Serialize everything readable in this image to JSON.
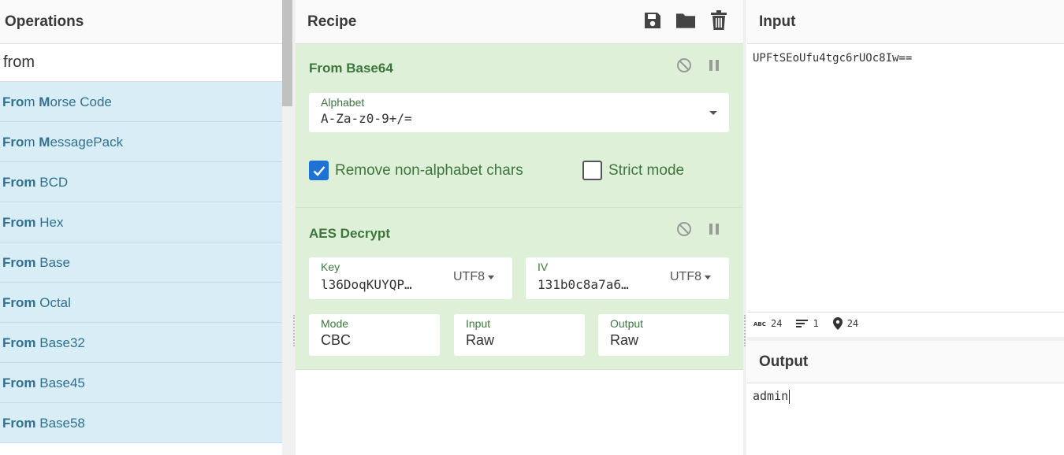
{
  "operations": {
    "title": "Operations",
    "search_value": "from",
    "items": [
      {
        "match": "Fro",
        "mid": "m ",
        "match2": "M",
        "rest": "orse Code"
      },
      {
        "match": "Fro",
        "mid": "m ",
        "match2": "M",
        "rest": "essagePack"
      },
      {
        "match": "From",
        "mid": " ",
        "match2": "",
        "rest": "BCD"
      },
      {
        "match": "From",
        "mid": " ",
        "match2": "",
        "rest": "Hex"
      },
      {
        "match": "From",
        "mid": " ",
        "match2": "",
        "rest": "Base"
      },
      {
        "match": "From",
        "mid": " ",
        "match2": "",
        "rest": "Octal"
      },
      {
        "match": "From",
        "mid": " ",
        "match2": "",
        "rest": "Base32"
      },
      {
        "match": "From",
        "mid": " ",
        "match2": "",
        "rest": "Base45"
      },
      {
        "match": "From",
        "mid": " ",
        "match2": "",
        "rest": "Base58"
      }
    ]
  },
  "recipe": {
    "title": "Recipe",
    "icons": [
      "save-icon",
      "folder-icon",
      "trash-icon"
    ],
    "from_base64": {
      "title": "From Base64",
      "alphabet_label": "Alphabet",
      "alphabet_value": "A-Za-z0-9+/=",
      "remove_label": "Remove non-alphabet chars",
      "remove_checked": true,
      "strict_label": "Strict mode",
      "strict_checked": false
    },
    "aes_decrypt": {
      "title": "AES Decrypt",
      "key_label": "Key",
      "key_value": "l36DoqKUYQP…",
      "key_encoding": "UTF8",
      "iv_label": "IV",
      "iv_value": "131b0c8a7a6…",
      "iv_encoding": "UTF8",
      "mode_label": "Mode",
      "mode_value": "CBC",
      "input_label": "Input",
      "input_value": "Raw",
      "output_label": "Output",
      "output_value": "Raw"
    }
  },
  "input": {
    "title": "Input",
    "text": "UPFtSEoUfu4tgc6rUOc8Iw==",
    "stats": {
      "chars": "24",
      "lines": "1",
      "position": "24"
    }
  },
  "output": {
    "title": "Output",
    "text": "admin"
  },
  "colors": {
    "ops_bg": "#d9edf7",
    "ops_text": "#31708f",
    "recipe_bg": "#dff0d8",
    "recipe_text": "#3c763d",
    "checkbox_on": "#1d72d3"
  }
}
